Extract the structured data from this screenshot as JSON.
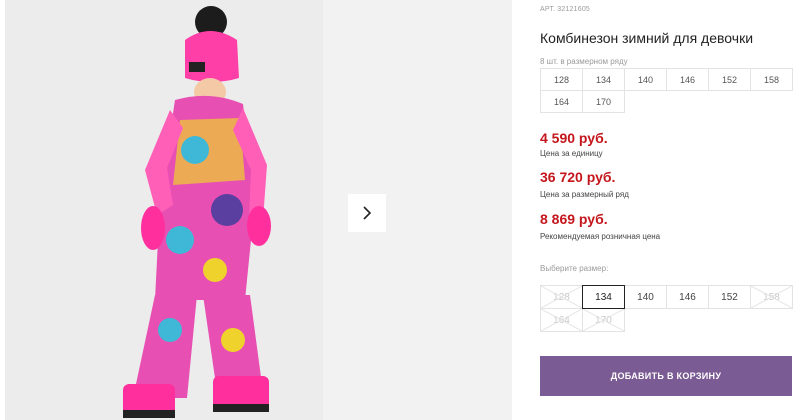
{
  "gallery": {
    "photo_alt": "Комбинезон зимний для девочки",
    "next_icon": "chevron-right-icon"
  },
  "product": {
    "sku_label": "АРТ.",
    "sku": "32121605",
    "title": "Комбинезон зимний для девочки"
  },
  "pack": {
    "label": "8 шт. в размерном ряду",
    "sizes": [
      "128",
      "134",
      "140",
      "146",
      "152",
      "158",
      "164",
      "170"
    ]
  },
  "prices": [
    {
      "value": "4 590 руб.",
      "label": "Цена за единицу"
    },
    {
      "value": "36 720 руб.",
      "label": "Цена за размерный ряд"
    },
    {
      "value": "8 869 руб.",
      "label": "Рекомендуемая розничная цена"
    }
  ],
  "size_select": {
    "label": "Выберите размер:",
    "options": [
      {
        "value": "128",
        "disabled": true,
        "selected": false
      },
      {
        "value": "134",
        "disabled": false,
        "selected": true
      },
      {
        "value": "140",
        "disabled": false,
        "selected": false
      },
      {
        "value": "146",
        "disabled": false,
        "selected": false
      },
      {
        "value": "152",
        "disabled": false,
        "selected": false
      },
      {
        "value": "158",
        "disabled": true,
        "selected": false
      },
      {
        "value": "164",
        "disabled": true,
        "selected": false
      },
      {
        "value": "170",
        "disabled": true,
        "selected": false
      }
    ]
  },
  "cart": {
    "label": "Добавить в корзину"
  },
  "colors": {
    "price": "#c4161c",
    "button": "#7b5b93"
  }
}
